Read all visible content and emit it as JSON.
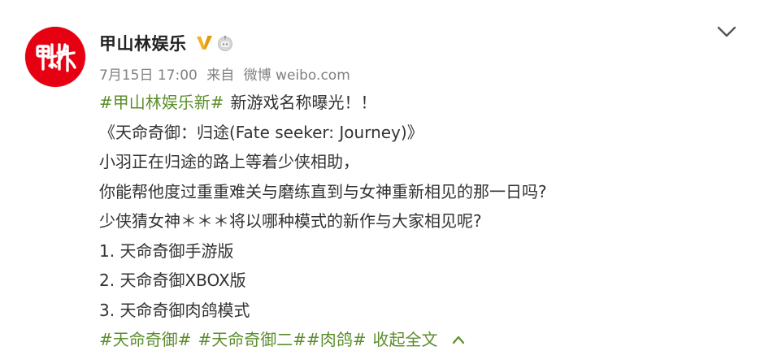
{
  "post": {
    "author_name": "甲山林娱乐",
    "avatar_text": "甲山林",
    "date": "7月15日 17:00",
    "source_prefix": "来自",
    "source": "微博 weibo.com",
    "icons": {
      "verified": "verified-v-icon",
      "robot": "robot-badge-icon",
      "expand": "chevron-down-icon",
      "collapse": "chevron-up-icon"
    },
    "colors": {
      "link": "#5b8e2b",
      "brand_red": "#e60012",
      "verified_gold": "#f4b223",
      "meta_gray": "#808080",
      "text": "#333333"
    },
    "lines": {
      "l1_tag": "#甲山林娱乐新#",
      "l1_text": "新游戏名称曝光！！",
      "l2": "《天命奇御：归途(Fate seeker: Journey)》",
      "l3": "小羽正在归途的路上等着少侠相助，",
      "l4": "你能帮他度过重重难关与磨练直到与女神重新相见的那一日吗?",
      "l5": "少侠猜女神＊＊＊将以哪种模式的新作与大家相见呢?",
      "l6": "1. 天命奇御手游版",
      "l7": "2. 天命奇御XBOX版",
      "l8": "3. 天命奇御肉鸽模式"
    },
    "tags": [
      "#天命奇御#",
      "#天命奇御二#",
      "#肉鸽#"
    ],
    "collapse_label": "收起全文"
  }
}
